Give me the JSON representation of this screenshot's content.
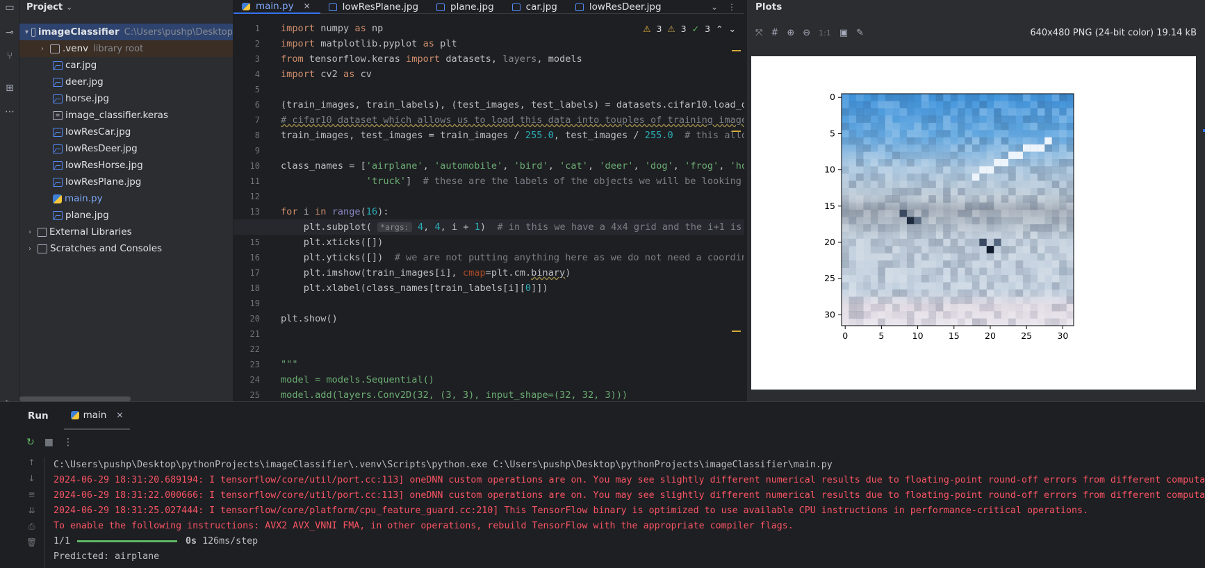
{
  "project": {
    "title": "Project",
    "root": {
      "name": "imageClassifier",
      "path": "C:\\Users\\pushp\\Desktop"
    },
    "venv": {
      "name": ".venv",
      "note": "library root"
    },
    "files": [
      {
        "name": "car.jpg",
        "icon": "image-file-icon"
      },
      {
        "name": "deer.jpg",
        "icon": "image-file-icon"
      },
      {
        "name": "horse.jpg",
        "icon": "image-file-icon"
      },
      {
        "name": "image_classifier.keras",
        "icon": "keras-file-icon"
      },
      {
        "name": "lowResCar.jpg",
        "icon": "image-file-icon"
      },
      {
        "name": "lowResDeer.jpg",
        "icon": "image-file-icon"
      },
      {
        "name": "lowResHorse.jpg",
        "icon": "image-file-icon"
      },
      {
        "name": "lowResPlane.jpg",
        "icon": "image-file-icon"
      },
      {
        "name": "main.py",
        "icon": "python-file-icon"
      },
      {
        "name": "plane.jpg",
        "icon": "image-file-icon"
      }
    ],
    "external": "External Libraries",
    "scratches": "Scratches and Consoles"
  },
  "editor": {
    "tabs": [
      "main.py",
      "lowResPlane.jpg",
      "plane.jpg",
      "car.jpg",
      "lowResDeer.jpg"
    ],
    "inspections": {
      "warnings": "3",
      "weak": "3",
      "ok": "3"
    },
    "current_line": 14
  },
  "plots": {
    "title": "Plots",
    "zoom_label": "1:1",
    "image_info": "640x480 PNG (24-bit color) 19.14 kB",
    "yticks": [
      "0",
      "5",
      "10",
      "15",
      "20",
      "25",
      "30"
    ],
    "xticks": [
      "0",
      "5",
      "10",
      "15",
      "20",
      "25",
      "30"
    ]
  },
  "run": {
    "title": "Run",
    "tab": "main",
    "lines": [
      "C:\\Users\\pushp\\Desktop\\pythonProjects\\imageClassifier\\.venv\\Scripts\\python.exe C:\\Users\\pushp\\Desktop\\pythonProjects\\imageClassifier\\main.py",
      "2024-06-29 18:31:20.689194: I tensorflow/core/util/port.cc:113] oneDNN custom operations are on. You may see slightly different numerical results due to floating-point round-off errors from different computa",
      "2024-06-29 18:31:22.000666: I tensorflow/core/util/port.cc:113] oneDNN custom operations are on. You may see slightly different numerical results due to floating-point round-off errors from different computa",
      "2024-06-29 18:31:25.027444: I tensorflow/core/platform/cpu_feature_guard.cc:210] This TensorFlow binary is optimized to use available CPU instructions in performance-critical operations.",
      "To enable the following instructions: AVX2 AVX_VNNI FMA, in other operations, rebuild TensorFlow with the appropriate compiler flags."
    ],
    "progress": {
      "count": "1/1",
      "fraction": 1.0,
      "time": "0s",
      "rate": "126ms/step"
    },
    "result": "Predicted: airplane"
  }
}
